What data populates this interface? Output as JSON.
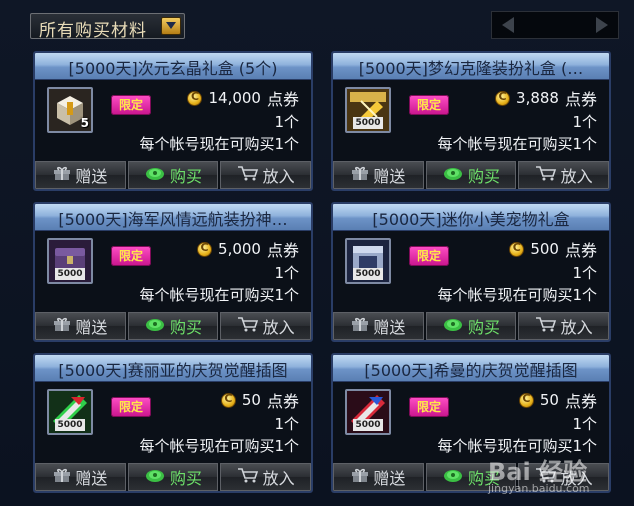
{
  "filter": {
    "label": "所有购买材料"
  },
  "buttons": {
    "gift": "赠送",
    "buy": "购买",
    "cart": "放入"
  },
  "items": [
    {
      "title": "[5000天]次元玄晶礼盒 (5个)",
      "badge": "限定",
      "price": "14,000",
      "unit": "点券",
      "count": "1个",
      "limit": "每个帐号现在可购买1个",
      "icon": "crystal-box-icon",
      "icon_qty": "5"
    },
    {
      "title": "[5000天]梦幻克隆装扮礼盒 (…",
      "badge": "限定",
      "price": "3,888",
      "unit": "点券",
      "count": "1个",
      "limit": "每个帐号现在可购买1个",
      "icon": "clone-box-icon",
      "icon_qty": "5000"
    },
    {
      "title": "[5000天]海军风情远航装扮神…",
      "badge": "限定",
      "price": "5,000",
      "unit": "点券",
      "count": "1个",
      "limit": "每个帐号现在可购买1个",
      "icon": "navy-chest-icon",
      "icon_qty": "5000"
    },
    {
      "title": "[5000天]迷你小美宠物礼盒",
      "badge": "限定",
      "price": "500",
      "unit": "点券",
      "count": "1个",
      "limit": "每个帐号现在可购买1个",
      "icon": "pet-box-icon",
      "icon_qty": "5000"
    },
    {
      "title": "[5000天]赛丽亚的庆贺觉醒插图",
      "badge": "限定",
      "price": "50",
      "unit": "点券",
      "count": "1个",
      "limit": "每个帐号现在可购买1个",
      "icon": "green-illustration-icon",
      "icon_qty": "5000"
    },
    {
      "title": "[5000天]希曼的庆贺觉醒插图",
      "badge": "限定",
      "price": "50",
      "unit": "点券",
      "count": "1个",
      "limit": "每个帐号现在可购买1个",
      "icon": "red-illustration-icon",
      "icon_qty": "5000"
    }
  ],
  "watermark": {
    "brand": "Bai 经验",
    "url": "jingyan.baidu.com"
  }
}
